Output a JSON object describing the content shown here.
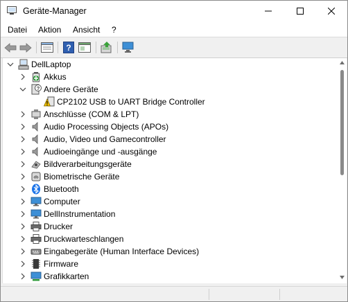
{
  "window": {
    "title": "Geräte-Manager"
  },
  "menu": [
    {
      "label": "Datei"
    },
    {
      "label": "Aktion"
    },
    {
      "label": "Ansicht"
    },
    {
      "label": "?"
    }
  ],
  "toolbar": {
    "buttons": [
      "back-arrow-icon",
      "forward-arrow-icon",
      "properties-icon",
      "help-icon",
      "show-hidden-icon",
      "update-driver-icon",
      "scan-hardware-icon"
    ]
  },
  "tree": {
    "root": "DellLaptop",
    "items": [
      {
        "label": "Akkus",
        "icon": "battery-icon",
        "expanded": false
      },
      {
        "label": "Andere Geräte",
        "icon": "unknown-device-icon",
        "expanded": true
      },
      {
        "label": "CP2102 USB to UART Bridge Controller",
        "icon": "warning-device-icon",
        "child": true
      },
      {
        "label": "Anschlüsse (COM & LPT)",
        "icon": "port-icon",
        "expanded": false
      },
      {
        "label": "Audio Processing Objects (APOs)",
        "icon": "speaker-icon",
        "expanded": false
      },
      {
        "label": "Audio, Video und Gamecontroller",
        "icon": "speaker-icon",
        "expanded": false
      },
      {
        "label": "Audioeingänge und -ausgänge",
        "icon": "speaker-icon",
        "expanded": false
      },
      {
        "label": "Bildverarbeitungsgeräte",
        "icon": "camera-icon",
        "expanded": false
      },
      {
        "label": "Biometrische Geräte",
        "icon": "fingerprint-icon",
        "expanded": false
      },
      {
        "label": "Bluetooth",
        "icon": "bluetooth-icon",
        "expanded": false
      },
      {
        "label": "Computer",
        "icon": "monitor-icon",
        "expanded": false
      },
      {
        "label": "DellInstrumentation",
        "icon": "monitor-icon",
        "expanded": false
      },
      {
        "label": "Drucker",
        "icon": "printer-icon",
        "expanded": false
      },
      {
        "label": "Druckwarteschlangen",
        "icon": "printer-icon",
        "expanded": false
      },
      {
        "label": "Eingabegeräte (Human Interface Devices)",
        "icon": "hid-icon",
        "expanded": false
      },
      {
        "label": "Firmware",
        "icon": "chip-icon",
        "expanded": false
      },
      {
        "label": "Grafikkarten",
        "icon": "display-adapter-icon",
        "expanded": false
      }
    ]
  },
  "colors": {
    "accent_blue": "#1e6fd0",
    "bluetooth": "#1a73e8",
    "warning": "#f2c200"
  }
}
